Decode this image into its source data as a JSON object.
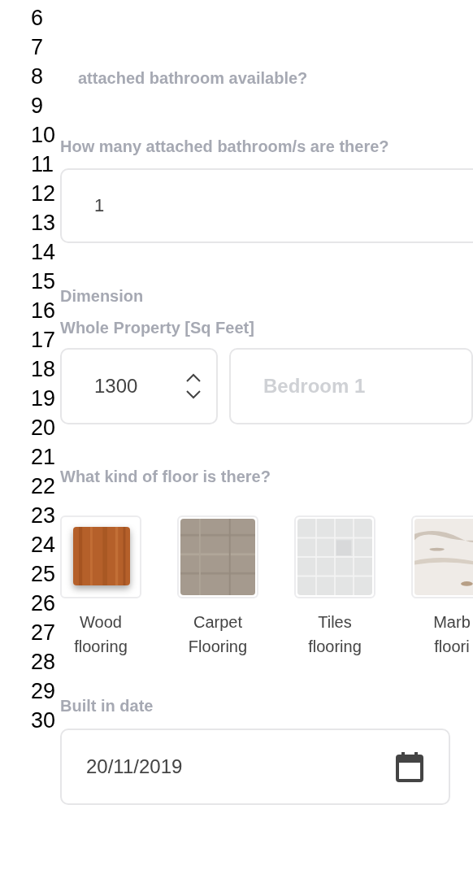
{
  "line_numbers": [
    "6",
    "7",
    "8",
    "9",
    "10",
    "11",
    "12",
    "13",
    "14",
    "15",
    "16",
    "17",
    "18",
    "19",
    "20",
    "21",
    "22",
    "23",
    "24",
    "25",
    "26",
    "27",
    "28",
    "29",
    "30"
  ],
  "bathroom_available": {
    "label": "attached bathroom available?"
  },
  "bathroom_count": {
    "label": "How many attached bathroom/s are there?",
    "value": "1"
  },
  "dimension": {
    "title": "Dimension",
    "whole_property": {
      "label": "Whole Property [Sq Feet]",
      "value": "1300"
    },
    "bedroom": {
      "placeholder": "Bedroom 1"
    }
  },
  "floor": {
    "label": "What kind of floor is there?",
    "options": [
      {
        "lines": [
          "Wood",
          "flooring"
        ],
        "selected": true
      },
      {
        "lines": [
          "Carpet",
          "Flooring"
        ],
        "selected": false
      },
      {
        "lines": [
          "Tiles",
          "flooring"
        ],
        "selected": false
      },
      {
        "lines": [
          "Marb",
          "floori"
        ],
        "selected": false
      }
    ]
  },
  "built_in": {
    "label": "Built in date",
    "value": "20/11/2019"
  }
}
